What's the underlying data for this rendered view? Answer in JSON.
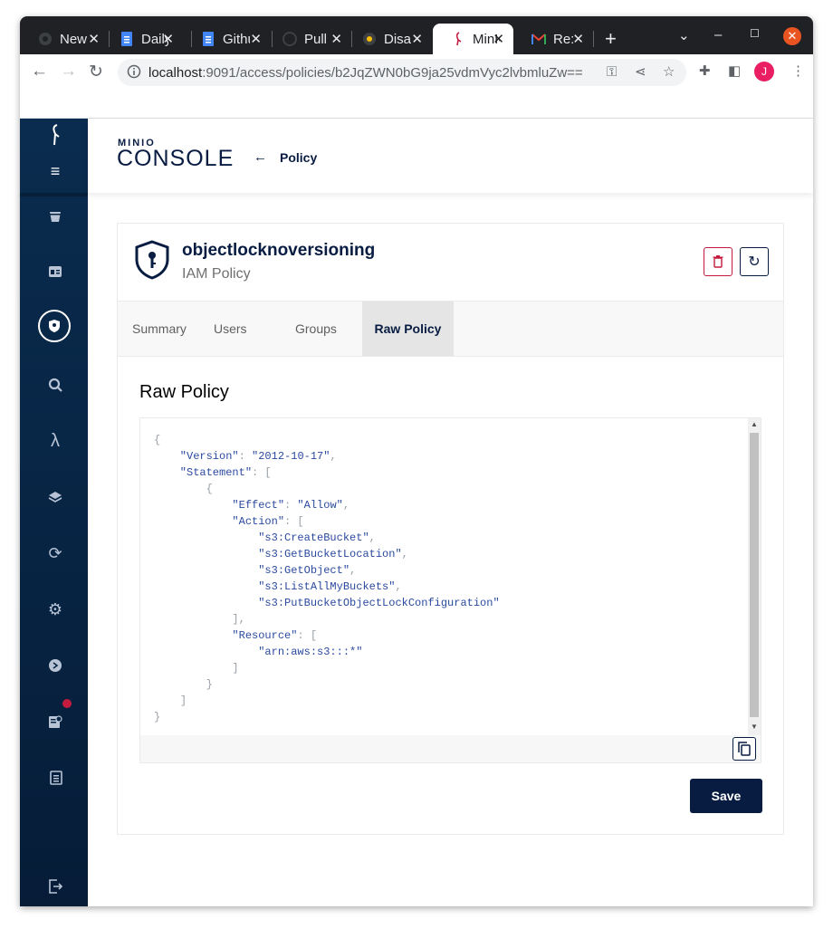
{
  "browser": {
    "tabs": [
      {
        "label": "New Tab",
        "icon": "chrome-icon"
      },
      {
        "label": "Daily",
        "icon": "docs-icon"
      },
      {
        "label": "Github",
        "icon": "docs-icon"
      },
      {
        "label": "Pull",
        "icon": "github-icon"
      },
      {
        "label": "Disa",
        "icon": "chrome-icon"
      },
      {
        "label": "MinIO",
        "icon": "minio-icon",
        "active": true
      },
      {
        "label": "Re:",
        "icon": "gmail-icon"
      }
    ],
    "close_glyph": "✕",
    "new_tab_glyph": "+",
    "url_host": "localhost",
    "url_path": ":9091/access/policies/b2JqZWN0bG9ja25vdmVyc2lvbmluZw==",
    "avatar_letter": "J"
  },
  "header": {
    "logo_top": "MINIO",
    "logo_bottom": "CONSOLE",
    "back_label": "Policy"
  },
  "policy": {
    "name": "objectlocknoversioning",
    "type": "IAM Policy"
  },
  "tabs": [
    "Summary",
    "Users",
    "Groups",
    "Raw Policy"
  ],
  "raw_policy": {
    "title": "Raw Policy",
    "version": "2012-10-17",
    "effect": "Allow",
    "actions": [
      "s3:CreateBucket",
      "s3:GetBucketLocation",
      "s3:GetObject",
      "s3:ListAllMyBuckets",
      "s3:PutBucketObjectLockConfiguration"
    ],
    "resources": [
      "arn:aws:s3:::*"
    ]
  },
  "save_label": "Save",
  "colors": {
    "brand_navy": "#081c42",
    "danger": "#c51b3f",
    "sidebar": "#072342"
  }
}
